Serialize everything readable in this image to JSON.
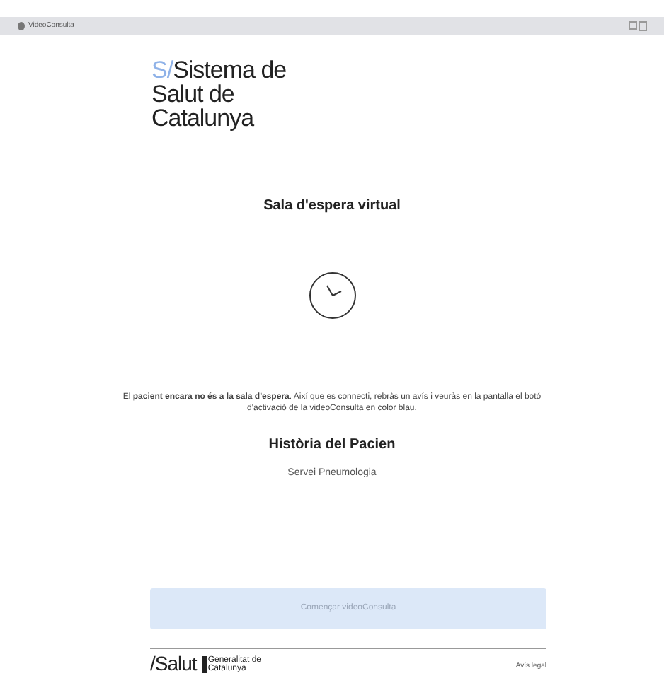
{
  "window": {
    "title": "VideoConsulta"
  },
  "logo": {
    "mark": "S/",
    "text": "Sistema de Salut de Catalunya"
  },
  "heading": "Sala d'espera virtual",
  "message": "El **pacient encara no és a la sala d'espera**. Així que es connecti, rebràs un avís i veuràs en la pantalla el botó d'activació de la videoConsulta en color blau.",
  "patient": {
    "title": "Història del Pacien",
    "service": "Servei Pneumologia"
  },
  "start_button": {
    "label": "Començar videoConsulta",
    "disabled": true
  },
  "footer": {
    "brand": "/Salut",
    "government": "Generalitat de Catalunya",
    "legal_link": "Avís legal"
  }
}
